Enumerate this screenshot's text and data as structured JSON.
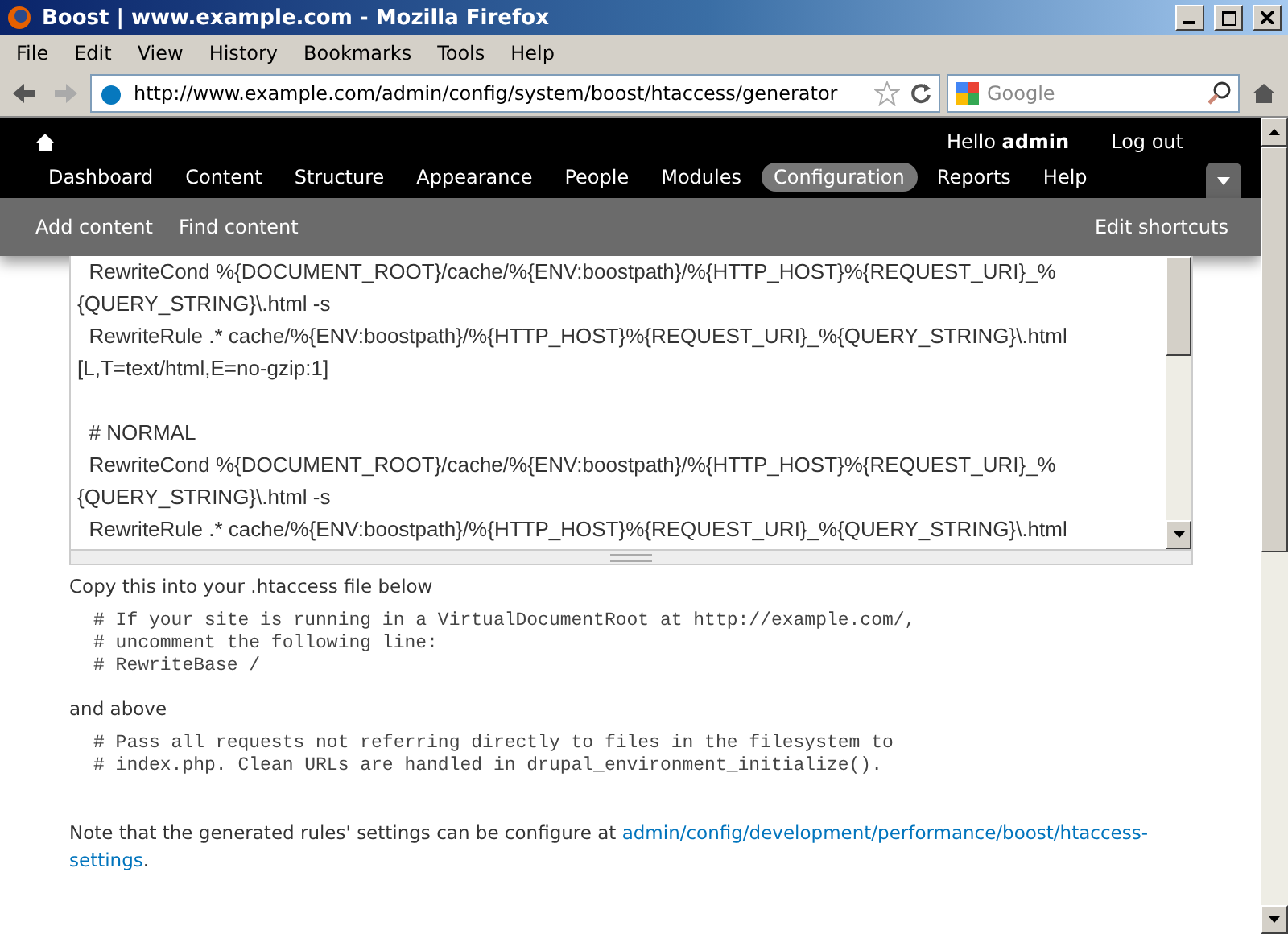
{
  "window": {
    "title": "Boost | www.example.com - Mozilla Firefox"
  },
  "menu_bar": [
    "File",
    "Edit",
    "View",
    "History",
    "Bookmarks",
    "Tools",
    "Help"
  ],
  "address_bar": {
    "url": "http://www.example.com/admin/config/system/boost/htaccess/generator"
  },
  "search": {
    "placeholder": "Google"
  },
  "toolbar": {
    "greeting": "Hello **admin**",
    "logout": "Log out",
    "nav": [
      {
        "label": "Dashboard",
        "selected": false
      },
      {
        "label": "Content",
        "selected": false
      },
      {
        "label": "Structure",
        "selected": false
      },
      {
        "label": "Appearance",
        "selected": false
      },
      {
        "label": "People",
        "selected": false
      },
      {
        "label": "Modules",
        "selected": false
      },
      {
        "label": "Configuration",
        "selected": true
      },
      {
        "label": "Reports",
        "selected": false
      },
      {
        "label": "Help",
        "selected": false
      }
    ],
    "shortcuts": [
      "Add content",
      "Find content"
    ],
    "edit_shortcuts": "Edit shortcuts"
  },
  "rules_textarea": {
    "groups": [
      [
        "  RewriteCond %{DOCUMENT_ROOT}/cache/%{ENV:boostpath}/%{HTTP_HOST}%{REQUEST_URI}_%",
        "{QUERY_STRING}\\.html -s",
        "  RewriteRule .* cache/%{ENV:boostpath}/%{HTTP_HOST}%{REQUEST_URI}_%{QUERY_STRING}\\.html",
        "[L,T=text/html,E=no-gzip:1]"
      ],
      [
        "  # NORMAL",
        "  RewriteCond %{DOCUMENT_ROOT}/cache/%{ENV:boostpath}/%{HTTP_HOST}%{REQUEST_URI}_%",
        "{QUERY_STRING}\\.html -s",
        "  RewriteRule .* cache/%{ENV:boostpath}/%{HTTP_HOST}%{REQUEST_URI}_%{QUERY_STRING}\\.html"
      ]
    ]
  },
  "instructions": [
    {
      "kind": "text",
      "text": "Copy this into your .htaccess file below"
    },
    {
      "kind": "code",
      "lines": [
        "# If your site is running in a VirtualDocumentRoot at http://example.com/,",
        "# uncomment the following line:",
        "# RewriteBase /"
      ]
    },
    {
      "kind": "text",
      "text": "and above"
    },
    {
      "kind": "code",
      "lines": [
        "# Pass all requests not referring directly to files in the filesystem to",
        "# index.php. Clean URLs are handled in drupal_environment_initialize()."
      ]
    }
  ],
  "note": {
    "text": "Note that the generated rules' settings can be configure at ",
    "link": [
      "admin/config/development/performance/boost/htaccess-",
      "settings"
    ],
    "after": "."
  }
}
